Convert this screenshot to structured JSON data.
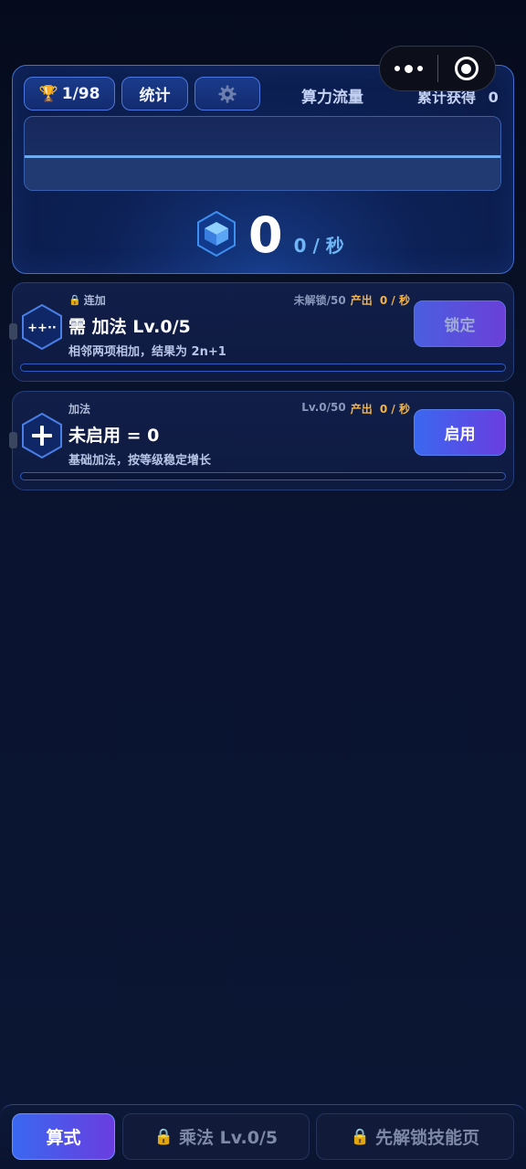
{
  "header": {
    "trophy_text": "1/98",
    "stats_label": "统计",
    "flow_title": "算力流量",
    "total_label": "累计获得",
    "total_value": "0"
  },
  "rate": {
    "value": "0",
    "unit": "0 / 秒"
  },
  "cards": [
    {
      "tag": "连加",
      "locked": true,
      "title": "需 加法 Lv.0/5",
      "desc": "相邻两项相加，结果为 2n+1",
      "level": "未解锁/50",
      "output_label": "产出",
      "output_value": "0 / 秒",
      "button": "锁定",
      "icon": "plus-plus-dots-icon"
    },
    {
      "tag": "加法",
      "locked": false,
      "title": "未启用 = 0",
      "desc": "基础加法，按等级稳定增长",
      "level": "Lv.0/50",
      "output_label": "产出",
      "output_value": "0 / 秒",
      "button": "启用",
      "icon": "plus-icon"
    }
  ],
  "nav": {
    "formula": "算式",
    "multiply": "乘法 Lv.0/5",
    "skills": "先解锁技能页"
  },
  "colors": {
    "accent_gold": "#f5b340",
    "accent_blue": "#3a68f0",
    "accent_purple": "#6a3de0",
    "panel_border": "#3f6fd1"
  }
}
